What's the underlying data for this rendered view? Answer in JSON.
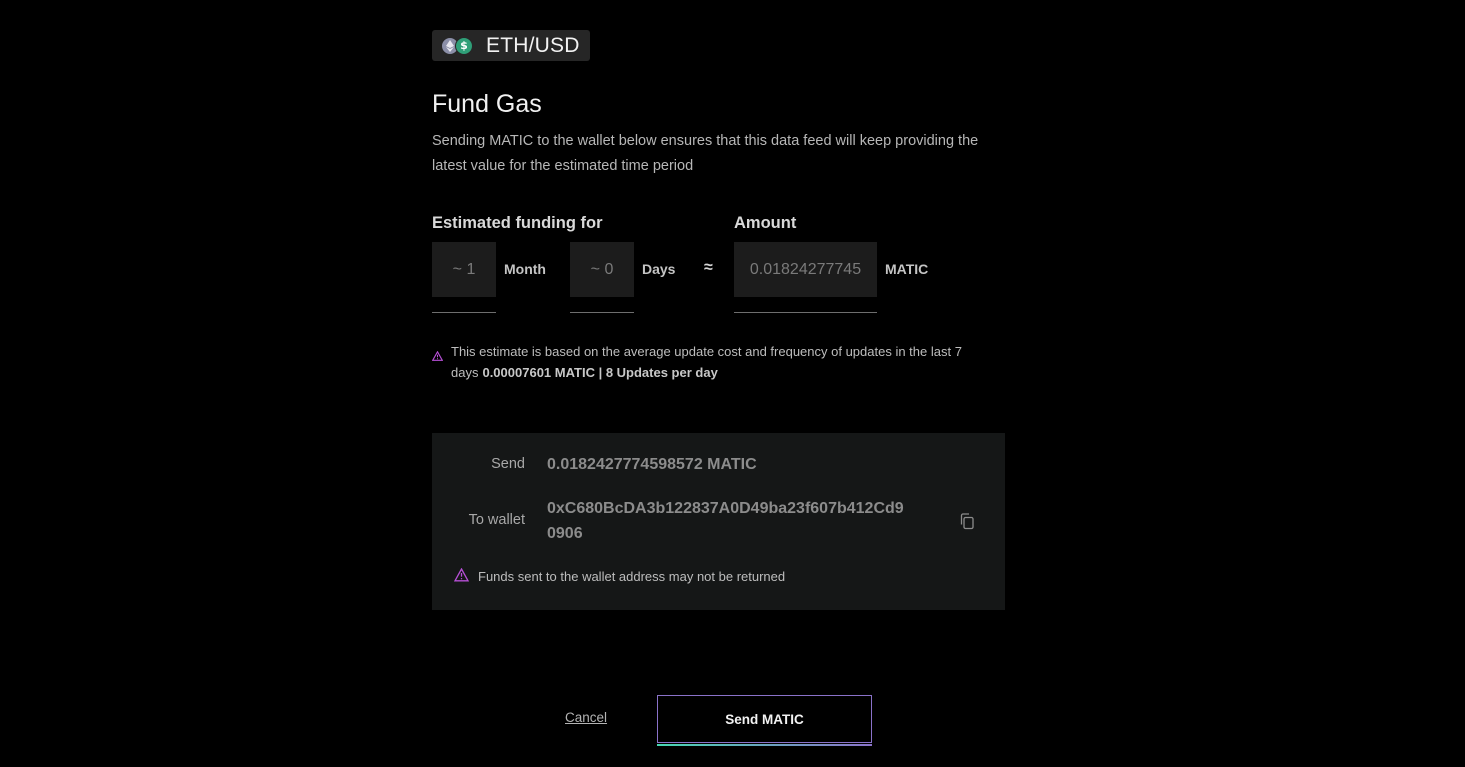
{
  "pair": {
    "label": "ETH/USD",
    "icons": [
      "eth-coin-icon",
      "usd-coin-icon"
    ],
    "usd_glyph": "$"
  },
  "header": {
    "title": "Fund Gas",
    "description": "Sending MATIC to the wallet below ensures that this data feed will keep providing the latest value for the estimated time period"
  },
  "funding": {
    "label": "Estimated funding for",
    "months_value": "~ 1",
    "months_unit": "Month",
    "days_value": "~ 0",
    "days_unit": "Days",
    "approx_symbol": "≈",
    "amount_label": "Amount",
    "amount_value": "0.01824277745",
    "amount_unit": "MATIC"
  },
  "estimate_note": {
    "text": "This estimate is based on the average update cost and frequency of updates in the last 7 days",
    "stats": "0.00007601 MATIC | 8 Updates per day"
  },
  "send_box": {
    "send_label": "Send",
    "send_value": "0.0182427774598572 MATIC",
    "wallet_label": "To wallet",
    "wallet_address_line1": "0xC680BcDA3b122837A0D49ba23f607b412Cd9",
    "wallet_address_line2": "0906",
    "warning": "Funds sent to the wallet address may not be returned"
  },
  "actions": {
    "cancel_label": "Cancel",
    "send_label": "Send MATIC"
  },
  "colors": {
    "background": "#000000",
    "panel": "#151717",
    "input_bg": "#1c1c1c",
    "warning_icon": "#b74fd6",
    "button_border": "#8a72c9",
    "button_accent_start": "#48d6b3"
  }
}
